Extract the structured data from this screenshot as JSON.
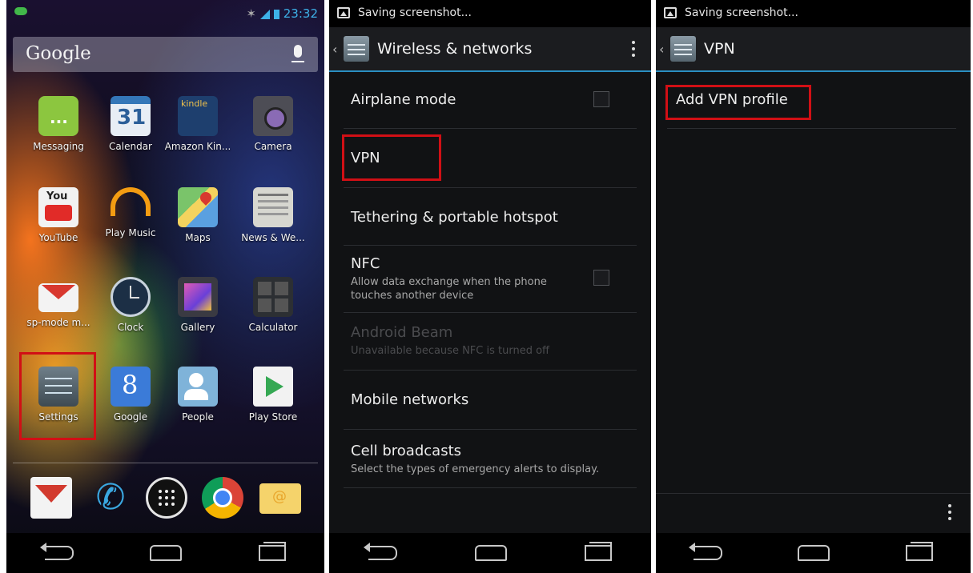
{
  "home": {
    "status_time": "23:32",
    "search_label": "Google",
    "apps": [
      {
        "label": "Messaging",
        "icon": "messaging-icon"
      },
      {
        "label": "Calendar",
        "icon": "calendar-icon",
        "glyph": "31"
      },
      {
        "label": "Amazon Kin...",
        "icon": "amazon-kindle-icon",
        "glyph": "kindle"
      },
      {
        "label": "Camera",
        "icon": "camera-icon"
      },
      {
        "label": "YouTube",
        "icon": "youtube-icon",
        "glyph": "You"
      },
      {
        "label": "Play Music",
        "icon": "headphones-icon"
      },
      {
        "label": "Maps",
        "icon": "maps-icon"
      },
      {
        "label": "News & We...",
        "icon": "news-weather-icon"
      },
      {
        "label": "sp-mode m...",
        "icon": "mail-icon"
      },
      {
        "label": "Clock",
        "icon": "clock-icon"
      },
      {
        "label": "Gallery",
        "icon": "gallery-icon"
      },
      {
        "label": "Calculator",
        "icon": "calculator-icon"
      },
      {
        "label": "Settings",
        "icon": "settings-icon"
      },
      {
        "label": "Google",
        "icon": "google-search-icon",
        "glyph": "8"
      },
      {
        "label": "People",
        "icon": "people-icon"
      },
      {
        "label": "Play Store",
        "icon": "play-store-icon"
      }
    ],
    "dock": [
      "gmail-icon",
      "phone-icon",
      "all-apps-icon",
      "chrome-icon",
      "email-icon"
    ]
  },
  "wireless": {
    "notification": "Saving screenshot...",
    "title": "Wireless & networks",
    "items": [
      {
        "title": "Airplane mode",
        "subtitle": ""
      },
      {
        "title": "VPN",
        "subtitle": ""
      },
      {
        "title": "Tethering & portable hotspot",
        "subtitle": ""
      },
      {
        "title": "NFC",
        "subtitle": "Allow data exchange when the phone touches another device"
      },
      {
        "title": "Android Beam",
        "subtitle": "Unavailable because NFC is turned off"
      },
      {
        "title": "Mobile networks",
        "subtitle": ""
      },
      {
        "title": "Cell broadcasts",
        "subtitle": "Select the types of emergency alerts to display."
      }
    ]
  },
  "vpn": {
    "notification": "Saving screenshot...",
    "title": "VPN",
    "add_profile": "Add VPN profile"
  },
  "colors": {
    "accent_blue": "#2a8fc2",
    "highlight_red": "#d10f15"
  }
}
